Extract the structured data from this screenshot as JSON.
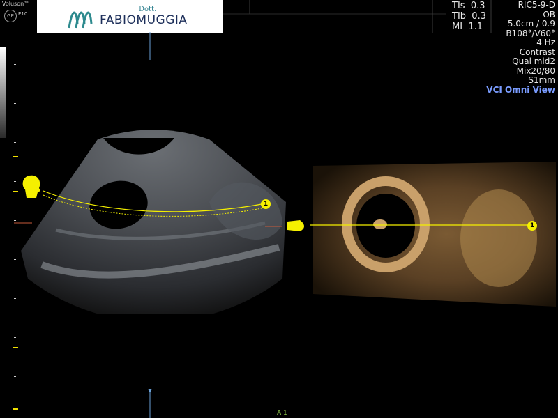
{
  "header": {
    "brand": "Voluson™",
    "ge": "GE",
    "model": "E10",
    "logo_dott": "Dott.",
    "logo_name_first": "FABIO",
    "logo_name_last": "MUGGIA"
  },
  "indices": [
    {
      "label": "TIs",
      "value": "0.3"
    },
    {
      "label": "TIb",
      "value": "0.3"
    },
    {
      "label": "MI",
      "value": "1.1"
    }
  ],
  "params": [
    "RIC5-9-D",
    "OB",
    "5.0cm / 0.9",
    "B108°/V60°",
    "4 Hz",
    "Contrast",
    "Qual mid2",
    "Mix20/80",
    "S1mm"
  ],
  "mode": "VCI Omni View",
  "markers": {
    "left": "1",
    "right": "1"
  },
  "bottom_indicator": "A 1",
  "colors": {
    "marker": "#f5f000",
    "mode": "#7a9cff",
    "render": "#b08a4f"
  }
}
